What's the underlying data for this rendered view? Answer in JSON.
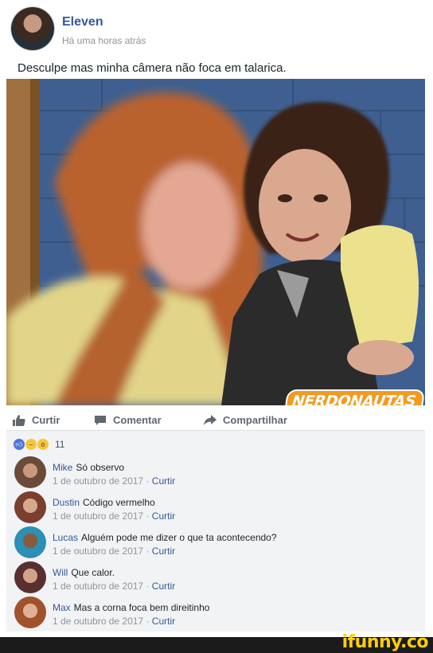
{
  "post": {
    "author": "Eleven",
    "time": "Há uma horas atrás",
    "text": "Desculpe mas minha câmera não foca em talarica.",
    "watermark": "NERDONAUTAS"
  },
  "actions": {
    "like": "Curtir",
    "comment": "Comentar",
    "share": "Compartilhar"
  },
  "reactions": {
    "icons": [
      "like-icon",
      "haha-icon",
      "wow-icon"
    ],
    "count": "11"
  },
  "comments": [
    {
      "author": "Mike",
      "text": "Só observo",
      "date": "1 de outubro de 2017",
      "like": "Curtir",
      "avatar_color": "#6b4a38"
    },
    {
      "author": "Dustin",
      "text": "Código vermelho",
      "date": "1 de outubro de 2017",
      "like": "Curtir",
      "avatar_color": "#7a3f2e"
    },
    {
      "author": "Lucas",
      "text": "Alguém pode me dizer o que ta acontecendo?",
      "date": "1 de outubro de 2017",
      "like": "Curtir",
      "avatar_color": "#2c8fb3"
    },
    {
      "author": "Will",
      "text": "Que calor.",
      "date": "1 de outubro de 2017",
      "like": "Curtir",
      "avatar_color": "#5a2f2f"
    },
    {
      "author": "Max",
      "text": "Mas a corna foca bem direitinho",
      "date": "1 de outubro de 2017",
      "like": "Curtir",
      "avatar_color": "#a0522d"
    }
  ],
  "footer": {
    "brand": "ifunny.co",
    "brand_color": "#ffce0a"
  },
  "colors": {
    "link": "#365899",
    "meta": "#90949c",
    "panel": "#f2f3f5"
  }
}
